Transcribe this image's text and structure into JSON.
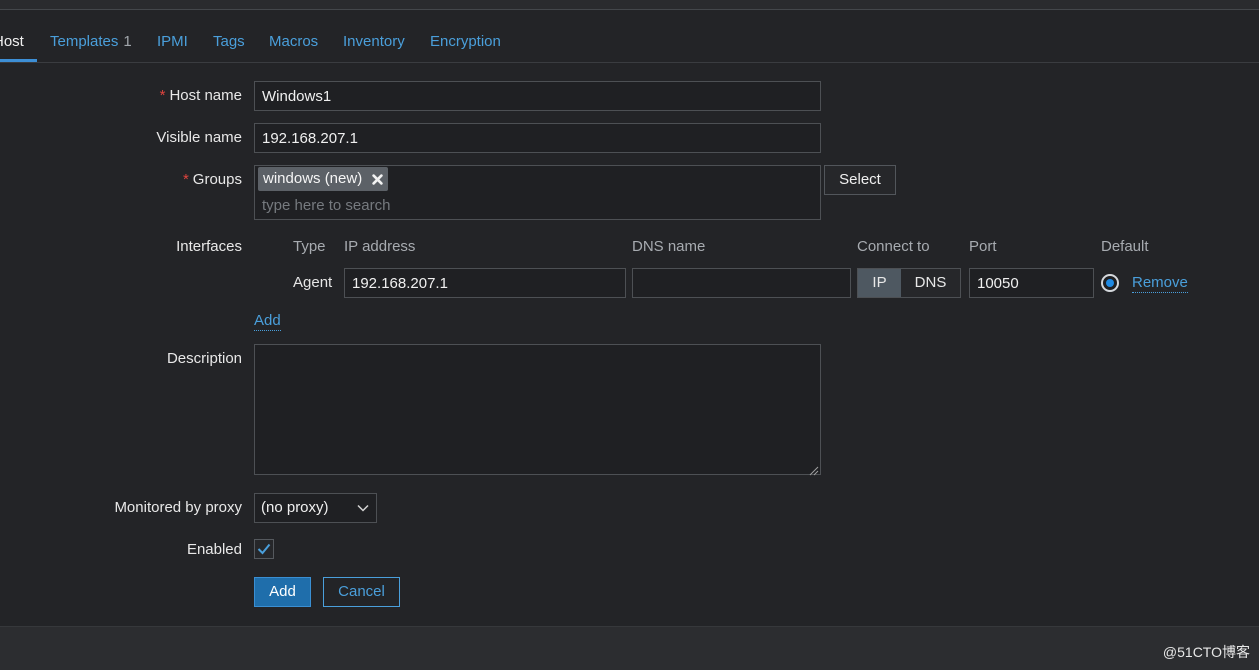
{
  "tabs": [
    {
      "label": "Host",
      "active": true
    },
    {
      "label": "Templates",
      "count": "1"
    },
    {
      "label": "IPMI"
    },
    {
      "label": "Tags"
    },
    {
      "label": "Macros"
    },
    {
      "label": "Inventory"
    },
    {
      "label": "Encryption"
    }
  ],
  "form": {
    "host_name": {
      "required": "*",
      "label": "Host name",
      "value": "Windows1"
    },
    "visible_name": {
      "label": "Visible name",
      "value": "192.168.207.1"
    },
    "groups": {
      "required": "*",
      "label": "Groups",
      "chips": [
        {
          "label": "windows (new)",
          "remove_icon": "close-icon"
        }
      ],
      "placeholder": "type here to search",
      "select_label": "Select"
    },
    "interfaces": {
      "label": "Interfaces",
      "headers": {
        "type": "Type",
        "ip": "IP address",
        "dns": "DNS name",
        "connect": "Connect to",
        "port": "Port",
        "default": "Default"
      },
      "rows": [
        {
          "type": "Agent",
          "ip": "192.168.207.1",
          "dns": "",
          "connect_options": [
            "IP",
            "DNS"
          ],
          "connect_selected_index": 0,
          "port": "10050",
          "default": true,
          "remove_label": "Remove"
        }
      ],
      "add_label": "Add"
    },
    "description": {
      "label": "Description",
      "value": "",
      "resize_icon": "resize-grip-icon"
    },
    "proxy": {
      "label": "Monitored by proxy",
      "selected": "(no proxy)",
      "icon": "chevron-down-icon"
    },
    "enabled": {
      "label": "Enabled",
      "checked": true,
      "icon": "checkmark-icon"
    },
    "buttons": {
      "add": "Add",
      "cancel": "Cancel"
    }
  },
  "footer": {
    "watermark": "@51CTO博客"
  },
  "colors": {
    "link": "#4a9fdb",
    "required": "#e0443e",
    "primary": "#1f6eab",
    "page_bg": "#232427"
  }
}
